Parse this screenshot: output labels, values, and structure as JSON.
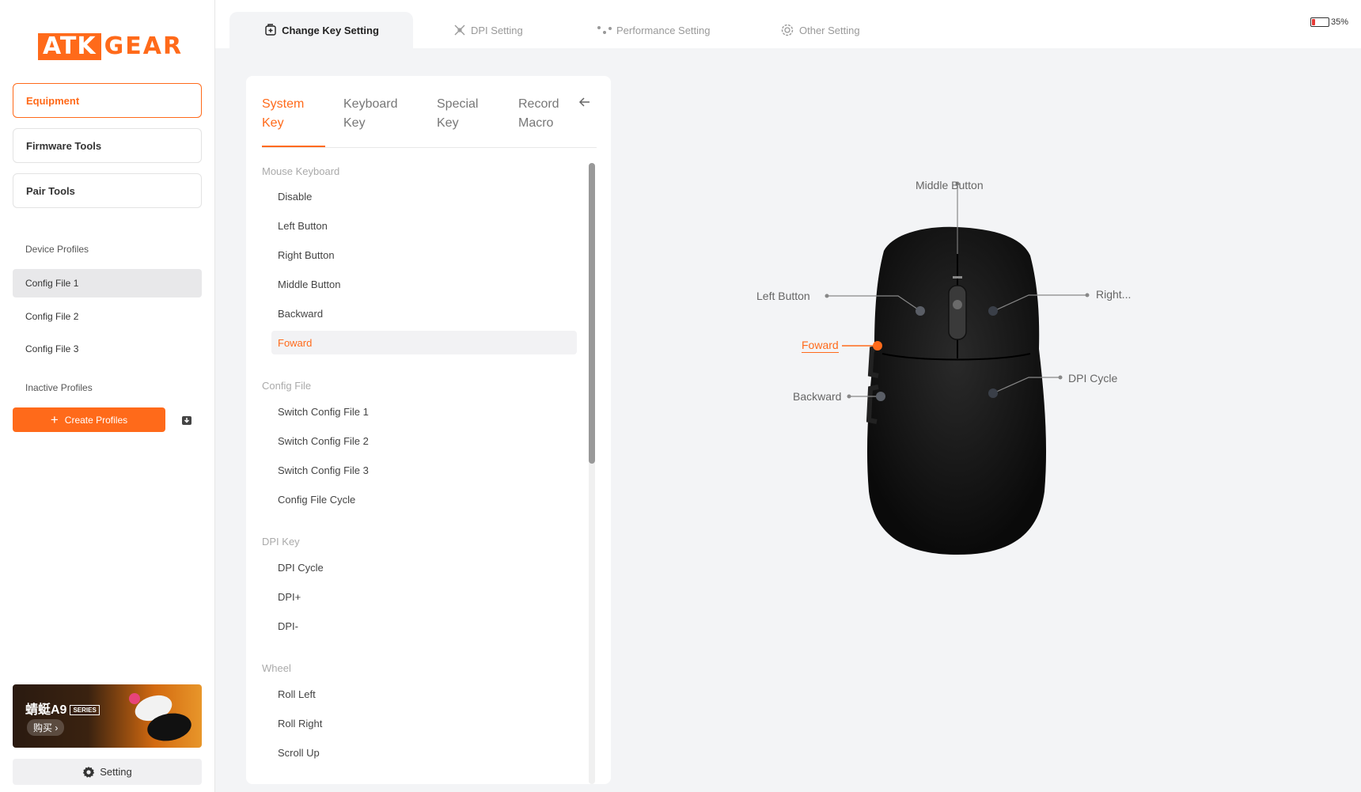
{
  "sidebar": {
    "logo": {
      "part1": "ATK",
      "part2": "GEAR"
    },
    "nav": [
      "Equipment",
      "Firmware Tools",
      "Pair Tools"
    ],
    "device_profiles_label": "Device Profiles",
    "profiles": [
      "Config File 1",
      "Config File 2",
      "Config File 3"
    ],
    "inactive_profiles_label": "Inactive Profiles",
    "create_profiles_label": "Create Profiles",
    "banner": {
      "title": "蜻蜓A9",
      "series": "SERIES",
      "buy": "购买 ›"
    },
    "setting_label": "Setting"
  },
  "topbar": {
    "tabs": [
      "Change Key Setting",
      "DPI Setting",
      "Performance Setting",
      "Other Setting"
    ],
    "battery": "35%"
  },
  "key_panel": {
    "tabs": [
      {
        "line1": "System",
        "line2": "Key"
      },
      {
        "line1": "Keyboard",
        "line2": "Key"
      },
      {
        "line1": "Special",
        "line2": "Key"
      },
      {
        "line1": "Record",
        "line2": "Macro"
      }
    ],
    "groups": [
      {
        "title": "Mouse Keyboard",
        "items": [
          "Disable",
          "Left Button",
          "Right Button",
          "Middle Button",
          "Backward",
          "Foward"
        ]
      },
      {
        "title": "Config File",
        "items": [
          "Switch Config File 1",
          "Switch Config File 2",
          "Switch Config File 3",
          "Config File Cycle"
        ]
      },
      {
        "title": "DPI Key",
        "items": [
          "DPI Cycle",
          "DPI+",
          "DPI-"
        ]
      },
      {
        "title": "Wheel",
        "items": [
          "Roll Left",
          "Roll Right",
          "Scroll Up"
        ]
      }
    ]
  },
  "mouse": {
    "labels": {
      "middle": "Middle Button",
      "left": "Left Button",
      "right": "Right...",
      "forward": "Foward",
      "backward": "Backward",
      "dpi": "DPI Cycle"
    }
  },
  "colors": {
    "accent": "#ff6a1a",
    "selected_bg": "#e8e8ea"
  }
}
